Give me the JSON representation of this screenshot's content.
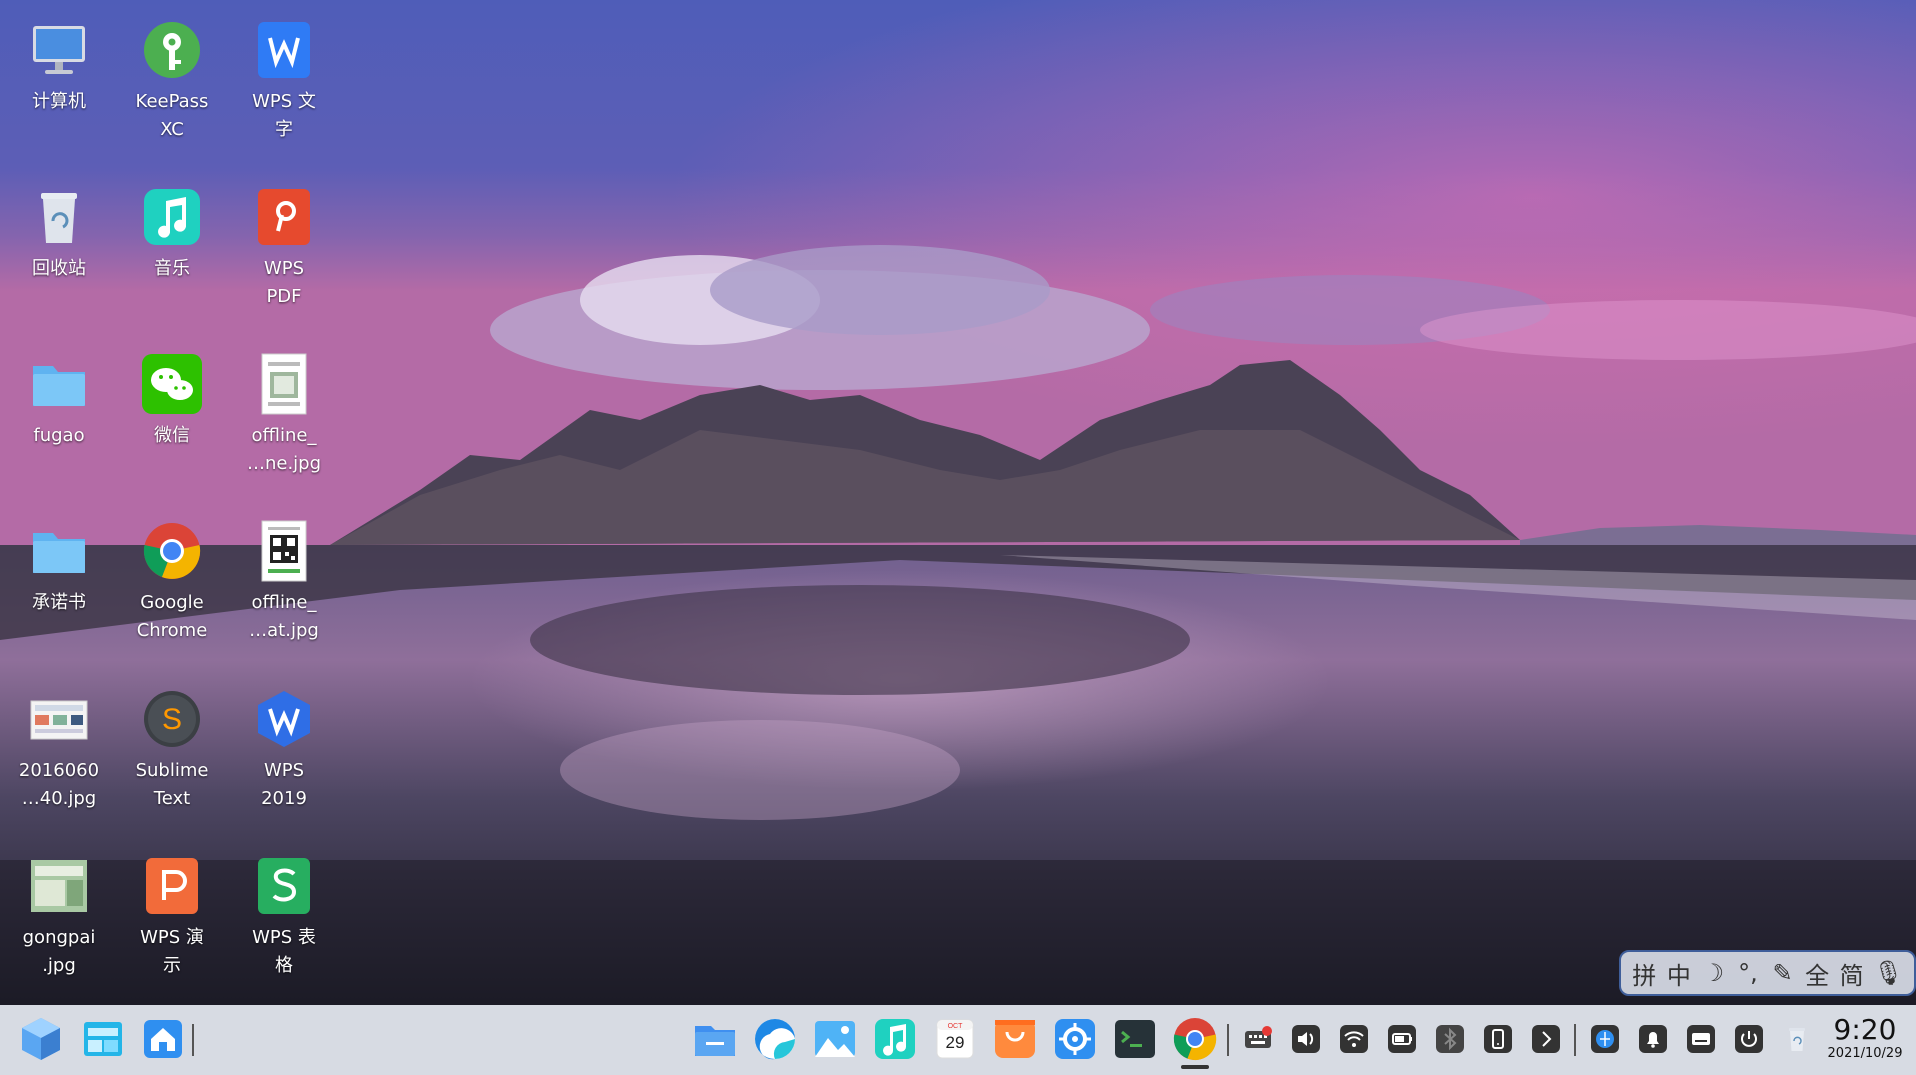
{
  "desktop": {
    "icons": [
      {
        "label": "计算机",
        "icon": "computer-icon"
      },
      {
        "label": "KeePass\nXC",
        "icon": "keepassxc-icon"
      },
      {
        "label": "WPS 文\n字",
        "icon": "wps-writer-icon"
      },
      {
        "label": "回收站",
        "icon": "trash-icon"
      },
      {
        "label": "音乐",
        "icon": "music-icon"
      },
      {
        "label": "WPS\nPDF",
        "icon": "wps-pdf-icon"
      },
      {
        "label": "fugao",
        "icon": "folder-icon"
      },
      {
        "label": "微信",
        "icon": "wechat-icon"
      },
      {
        "label": "offline_\n…ne.jpg",
        "icon": "image-file-icon"
      },
      {
        "label": "承诺书",
        "icon": "folder-icon"
      },
      {
        "label": "Google\nChrome",
        "icon": "chrome-icon"
      },
      {
        "label": "offline_\n…at.jpg",
        "icon": "qrcode-image-icon"
      },
      {
        "label": "2016060\n…40.jpg",
        "icon": "image-file-icon"
      },
      {
        "label": "Sublime\nText",
        "icon": "sublime-text-icon"
      },
      {
        "label": "WPS\n2019",
        "icon": "wps-2019-icon"
      },
      {
        "label": "gongpai\n.jpg",
        "icon": "image-file-icon"
      },
      {
        "label": "WPS 演\n示",
        "icon": "wps-presentation-icon"
      },
      {
        "label": "WPS 表\n格",
        "icon": "wps-spreadsheet-icon"
      }
    ]
  },
  "ime_toolbar": {
    "items": [
      "拼",
      "中",
      "☽",
      "°,",
      "✎",
      "全",
      "简",
      "🎙"
    ]
  },
  "taskbar": {
    "clock_time": "9:20",
    "clock_date": "2021/10/29",
    "calendar_month": "OCT",
    "calendar_day": "29",
    "left_items": [
      "start-menu-icon",
      "multitask-view-icon",
      "home-folder-icon"
    ],
    "center_apps": [
      "file-manager-icon",
      "browser-icon",
      "image-viewer-icon",
      "music-player-icon",
      "calendar-icon",
      "app-store-icon",
      "settings-icon",
      "terminal-icon",
      "chrome-icon"
    ],
    "tray_items": [
      "keyboard-input-icon",
      "volume-icon",
      "wifi-icon",
      "battery-icon",
      "bluetooth-icon",
      "phone-icon",
      "chevron-right-icon",
      "network-globe-icon",
      "notification-bell-icon",
      "onscreen-keyboard-icon",
      "power-icon",
      "trash-icon"
    ]
  },
  "colors": {
    "accent": "#3f5e9a",
    "taskbar_bg": "#cdd2dc"
  }
}
